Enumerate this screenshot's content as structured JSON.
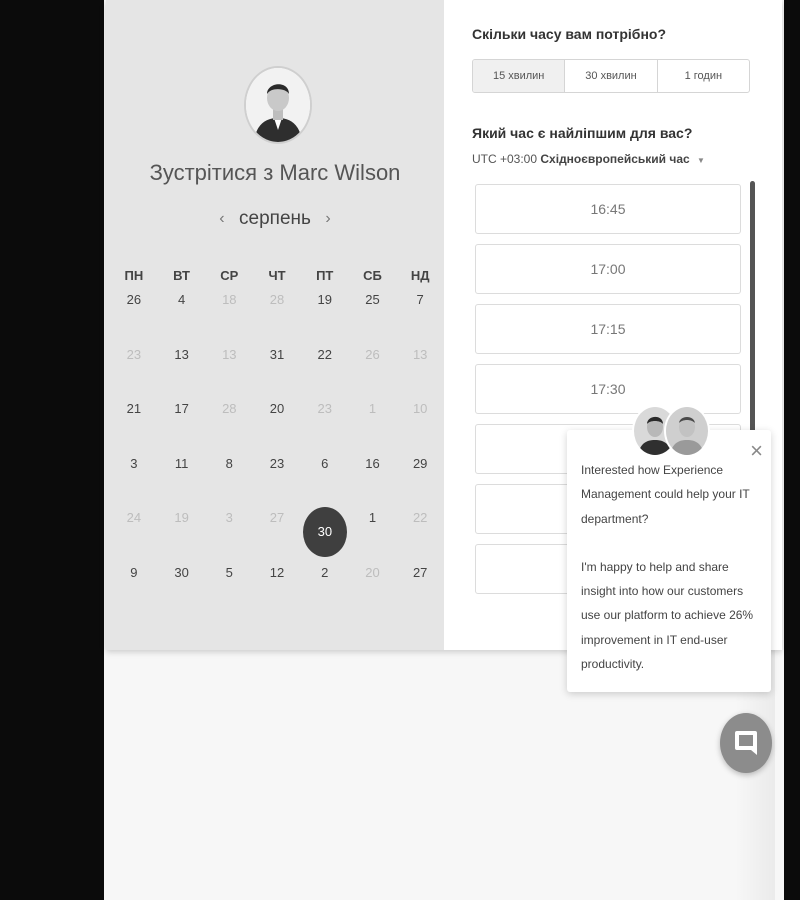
{
  "scheduler": {
    "title_prefix": "Зустрітися з",
    "host_name": "Marc Wilson",
    "month": "серпень",
    "weekdays": [
      "ПН",
      "ВТ",
      "СР",
      "ЧТ",
      "ПТ",
      "СБ",
      "НД"
    ],
    "calendar_rows": [
      [
        {
          "d": "26",
          "dim": false
        },
        {
          "d": "4",
          "dim": false
        },
        {
          "d": "18",
          "dim": true
        },
        {
          "d": "28",
          "dim": true
        },
        {
          "d": "19",
          "dim": false
        },
        {
          "d": "25",
          "dim": false
        },
        {
          "d": "7",
          "dim": false
        }
      ],
      [
        {
          "d": "23",
          "dim": true
        },
        {
          "d": "13",
          "dim": false
        },
        {
          "d": "13",
          "dim": true
        },
        {
          "d": "31",
          "dim": false
        },
        {
          "d": "22",
          "dim": false
        },
        {
          "d": "26",
          "dim": true
        },
        {
          "d": "13",
          "dim": true
        }
      ],
      [
        {
          "d": "21",
          "dim": false
        },
        {
          "d": "17",
          "dim": false
        },
        {
          "d": "28",
          "dim": true
        },
        {
          "d": "20",
          "dim": false
        },
        {
          "d": "23",
          "dim": true
        },
        {
          "d": "1",
          "dim": true
        },
        {
          "d": "10",
          "dim": true
        }
      ],
      [
        {
          "d": "3",
          "dim": false
        },
        {
          "d": "11",
          "dim": false
        },
        {
          "d": "8",
          "dim": false
        },
        {
          "d": "23",
          "dim": false
        },
        {
          "d": "6",
          "dim": false
        },
        {
          "d": "16",
          "dim": false
        },
        {
          "d": "29",
          "dim": false
        }
      ],
      [
        {
          "d": "24",
          "dim": true
        },
        {
          "d": "19",
          "dim": true
        },
        {
          "d": "3",
          "dim": true
        },
        {
          "d": "27",
          "dim": true
        },
        {
          "d": "30",
          "dim": false,
          "selected": true
        },
        {
          "d": "1",
          "dim": false
        },
        {
          "d": "22",
          "dim": true
        }
      ],
      [
        {
          "d": "9",
          "dim": false
        },
        {
          "d": "30",
          "dim": false
        },
        {
          "d": "5",
          "dim": false
        },
        {
          "d": "12",
          "dim": false
        },
        {
          "d": "2",
          "dim": false
        },
        {
          "d": "20",
          "dim": true
        },
        {
          "d": "27",
          "dim": false
        }
      ]
    ],
    "duration_question": "Скільки часу вам потрібно?",
    "durations": [
      "15 хвилин",
      "30 хвилин",
      "1 годин"
    ],
    "active_duration": 0,
    "time_question": "Який час є найліпшим для вас?",
    "timezone_offset": "UTC +03:00",
    "timezone_name": "Східноєвропейський час",
    "slots": [
      "16:45",
      "17:00",
      "17:15",
      "17:30",
      "",
      "",
      "",
      ""
    ]
  },
  "chat": {
    "message_1": "Interested how Experience Management could help your IT department?",
    "message_2": "I'm happy to help and share insight into how our customers use our platform to achieve 26% improvement in IT end-user productivity.",
    "close_symbol": "×"
  },
  "icons": {
    "prev": "‹",
    "next": "›",
    "caret": "▼"
  },
  "colors": {
    "left_panel_bg": "#e5e5e5",
    "selected_day": "#3f3f3f",
    "chat_button": "#8c8c8c"
  }
}
